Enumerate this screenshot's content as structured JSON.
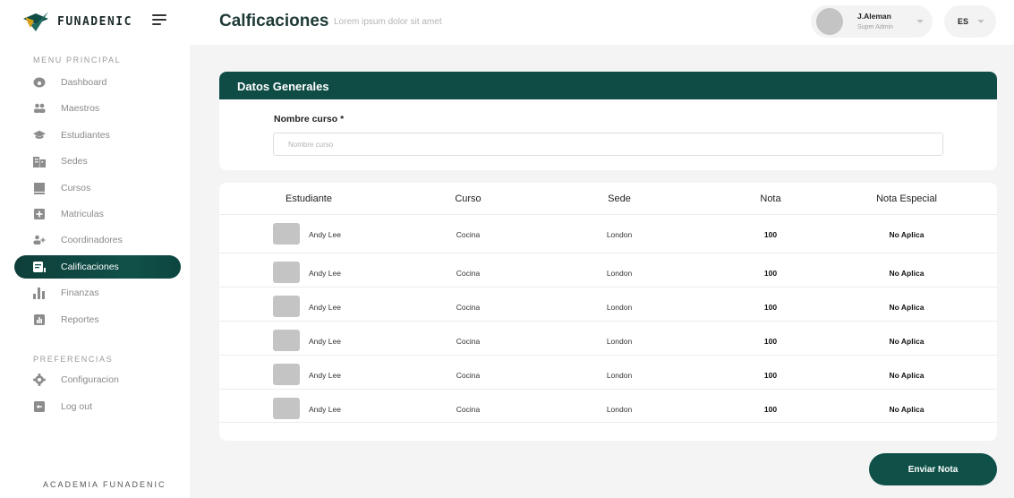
{
  "brand": {
    "name": "FUNADENIC",
    "logo_icon": "funadenic-logo-icon",
    "accent": "#0f4c46"
  },
  "header": {
    "title": "Calficaciones",
    "subtitle": "Lorem ipsum  dolor sit amet",
    "user": {
      "name": "J.Aleman",
      "role": "Super Admin"
    },
    "language": "ES"
  },
  "sidebar": {
    "main_label": "MENU PRINCIPAL",
    "items": [
      {
        "label": "Dashboard",
        "icon": "dashboard-icon"
      },
      {
        "label": "Maestros",
        "icon": "users-icon"
      },
      {
        "label": "Estudiantes",
        "icon": "graduation-cap-icon"
      },
      {
        "label": "Sedes",
        "icon": "building-icon"
      },
      {
        "label": "Cursos",
        "icon": "book-icon"
      },
      {
        "label": "Matriculas",
        "icon": "plus-square-icon"
      },
      {
        "label": "Coordinadores",
        "icon": "add-user-icon"
      },
      {
        "label": "Calificaciones",
        "icon": "grades-icon",
        "active": true
      },
      {
        "label": "Finanzas",
        "icon": "bar-chart-icon"
      },
      {
        "label": "Reportes",
        "icon": "report-icon"
      }
    ],
    "prefs_label": "PREFERENCIAS",
    "pref_items": [
      {
        "label": "Configuracion",
        "icon": "gear-icon"
      },
      {
        "label": "Log out",
        "icon": "logout-icon"
      }
    ],
    "footer": "ACADEMIA FUNADENIC"
  },
  "general": {
    "title": "Datos Generales",
    "course_label": "Nombre curso *",
    "course_placeholder": "Nombre curso",
    "course_value": ""
  },
  "table": {
    "headers": [
      "Estudiante",
      "Curso",
      "Sede",
      "Nota",
      "Nota Especial"
    ],
    "rows": [
      {
        "student": "Andy Lee",
        "course": "Cocina",
        "site": "London",
        "grade": "100",
        "special": "No Aplica"
      },
      {
        "student": "Andy Lee",
        "course": "Cocina",
        "site": "London",
        "grade": "100",
        "special": "No Aplica"
      },
      {
        "student": "Andy Lee",
        "course": "Cocina",
        "site": "London",
        "grade": "100",
        "special": "No Aplica"
      },
      {
        "student": "Andy Lee",
        "course": "Cocina",
        "site": "London",
        "grade": "100",
        "special": "No Aplica"
      },
      {
        "student": "Andy Lee",
        "course": "Cocina",
        "site": "London",
        "grade": "100",
        "special": "No Aplica"
      },
      {
        "student": "Andy Lee",
        "course": "Cocina",
        "site": "London",
        "grade": "100",
        "special": "No Aplica"
      }
    ]
  },
  "actions": {
    "submit_label": "Enviar Nota"
  }
}
